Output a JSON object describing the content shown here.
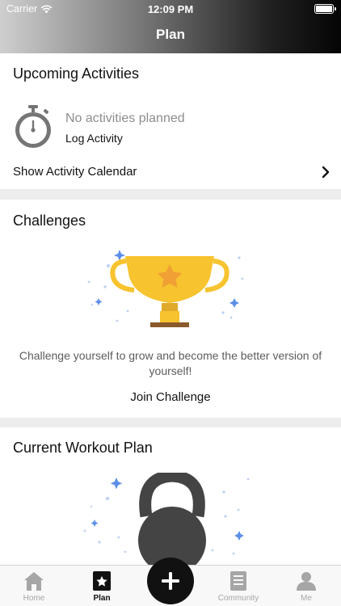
{
  "status_bar": {
    "carrier": "Carrier",
    "time": "12:09 PM"
  },
  "header": {
    "title": "Plan"
  },
  "upcoming": {
    "title": "Upcoming Activities",
    "empty_text": "No activities planned",
    "log_label": "Log Activity",
    "calendar_label": "Show Activity Calendar"
  },
  "challenges": {
    "title": "Challenges",
    "description": "Challenge yourself to grow and become the better version of yourself!",
    "join_label": "Join Challenge"
  },
  "workout": {
    "title": "Current Workout Plan"
  },
  "tabs": [
    {
      "label": "Home",
      "icon": "home-icon"
    },
    {
      "label": "Plan",
      "icon": "plan-star-icon",
      "active": true
    },
    {
      "label": "Community",
      "icon": "community-icon"
    },
    {
      "label": "Me",
      "icon": "person-icon"
    }
  ],
  "fab": {
    "icon": "plus-icon"
  },
  "colors": {
    "trophy": "#f7c32e",
    "trophy_base": "#8a5a2b",
    "kettlebell": "#444444",
    "sparkle": "#5b8fe8"
  }
}
